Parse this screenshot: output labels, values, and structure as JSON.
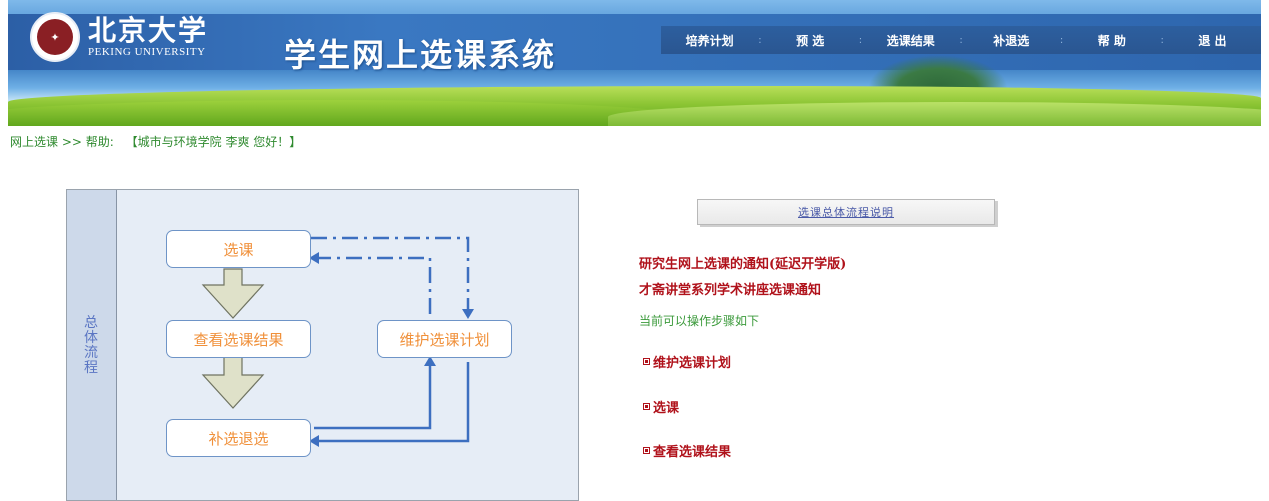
{
  "header": {
    "logo_cn": "北京大学",
    "logo_en": "PEKING UNIVERSITY",
    "system_title": "学生网上选课系统",
    "nav": [
      "培养计划",
      "预 选",
      "选课结果",
      "补退选",
      "帮 助",
      "退 出"
    ]
  },
  "breadcrumb": {
    "root": "网上选课",
    "sep": ">>",
    "current": "帮助:",
    "greeting": "【城市与环境学院 李爽 您好！】"
  },
  "diagram": {
    "side_label": "总体流程",
    "boxes": {
      "select": "选课",
      "view_results": "查看选课结果",
      "add_drop": "补选退选",
      "maintain_plan": "维护选课计划"
    }
  },
  "panel": {
    "flow_button": "选课总体流程说明",
    "notices": [
      "研究生网上选课的通知(延迟开学版)",
      "才斋讲堂系列学术讲座选课通知"
    ],
    "steps_title": "当前可以操作步骤如下",
    "steps": [
      "维护选课计划",
      "选课",
      "查看选课结果"
    ]
  },
  "colors": {
    "nav_bar": "#2d5f9f",
    "notice_red": "#b0121b",
    "breadcrumb_green": "#2f8a2f",
    "box_text_orange": "#f0903a",
    "arrow_blue": "#3d6fc0"
  }
}
